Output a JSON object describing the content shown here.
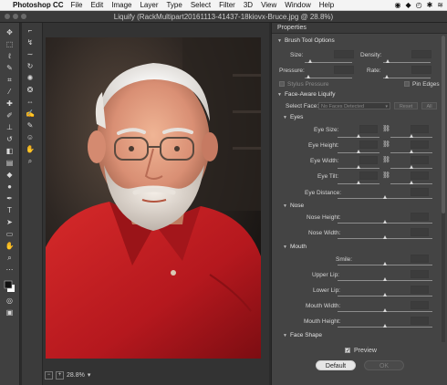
{
  "menubar": {
    "apple_icon": "apple-logo",
    "app_name": "Photoshop CC",
    "items": [
      "File",
      "Edit",
      "Image",
      "Layer",
      "Type",
      "Select",
      "Filter",
      "3D",
      "View",
      "Window",
      "Help"
    ]
  },
  "window": {
    "title": "Liquify (RackMultipart20161113-41437-18kiovx-Bruce.jpg @ 28.8%)"
  },
  "canvas": {
    "zoom": "28.8%"
  },
  "properties": {
    "title": "Properties",
    "brush_tool_options": {
      "heading": "Brush Tool Options",
      "size_label": "Size:",
      "density_label": "Density:",
      "pressure_label": "Pressure:",
      "rate_label": "Rate:",
      "stylus_pressure_label": "Stylus Pressure",
      "pin_edges_label": "Pin Edges"
    },
    "face_aware": {
      "heading": "Face-Aware Liquify",
      "select_face_label": "Select Face:",
      "select_face_value": "No Faces Detected",
      "reset_label": "Reset",
      "all_label": "All"
    },
    "eyes": {
      "heading": "Eyes",
      "eye_size": "Eye Size:",
      "eye_height": "Eye Height:",
      "eye_width": "Eye Width:",
      "eye_tilt": "Eye Tilt:",
      "eye_distance": "Eye Distance:"
    },
    "nose": {
      "heading": "Nose",
      "nose_height": "Nose Height:",
      "nose_width": "Nose Width:"
    },
    "mouth": {
      "heading": "Mouth",
      "smile": "Smile:",
      "upper_lip": "Upper Lip:",
      "lower_lip": "Lower Lip:",
      "mouth_width": "Mouth Width:",
      "mouth_height": "Mouth Height:"
    },
    "face_shape": {
      "heading": "Face Shape"
    }
  },
  "footer": {
    "preview_label": "Preview",
    "default_label": "Default",
    "ok_label": "OK"
  },
  "colors": {
    "accent": "#b8b8b8",
    "panel_bg": "#444444",
    "shirt_red": "#c01d22"
  }
}
